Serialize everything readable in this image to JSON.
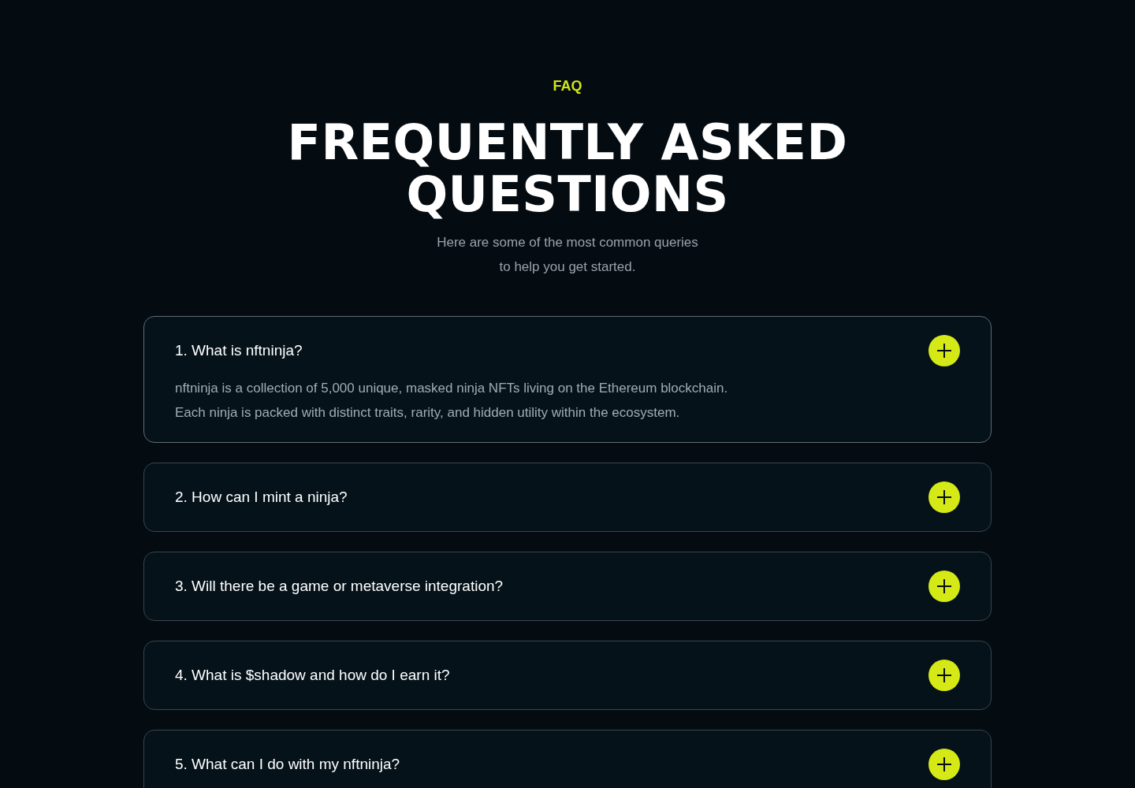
{
  "section": {
    "eyebrow": "FAQ",
    "title": "FREQUENTLY ASKED QUESTIONS",
    "subtitle": [
      "Here are some of the most common queries",
      "to help you get started."
    ]
  },
  "faq": [
    {
      "question": "1. What is nftninja?",
      "expanded": true,
      "answer": [
        "nftninja is a collection of 5,000 unique, masked ninja NFTs living on the Ethereum blockchain.",
        "Each ninja is packed with distinct traits, rarity, and hidden utility within the ecosystem."
      ]
    },
    {
      "question": "2. How can I mint a ninja?",
      "expanded": false
    },
    {
      "question": "3. Will there be a game or metaverse integration?",
      "expanded": false
    },
    {
      "question": "4. What is $shadow and how do I earn it?",
      "expanded": false
    },
    {
      "question": "5. What can I do with my nftninja?",
      "expanded": false
    }
  ]
}
